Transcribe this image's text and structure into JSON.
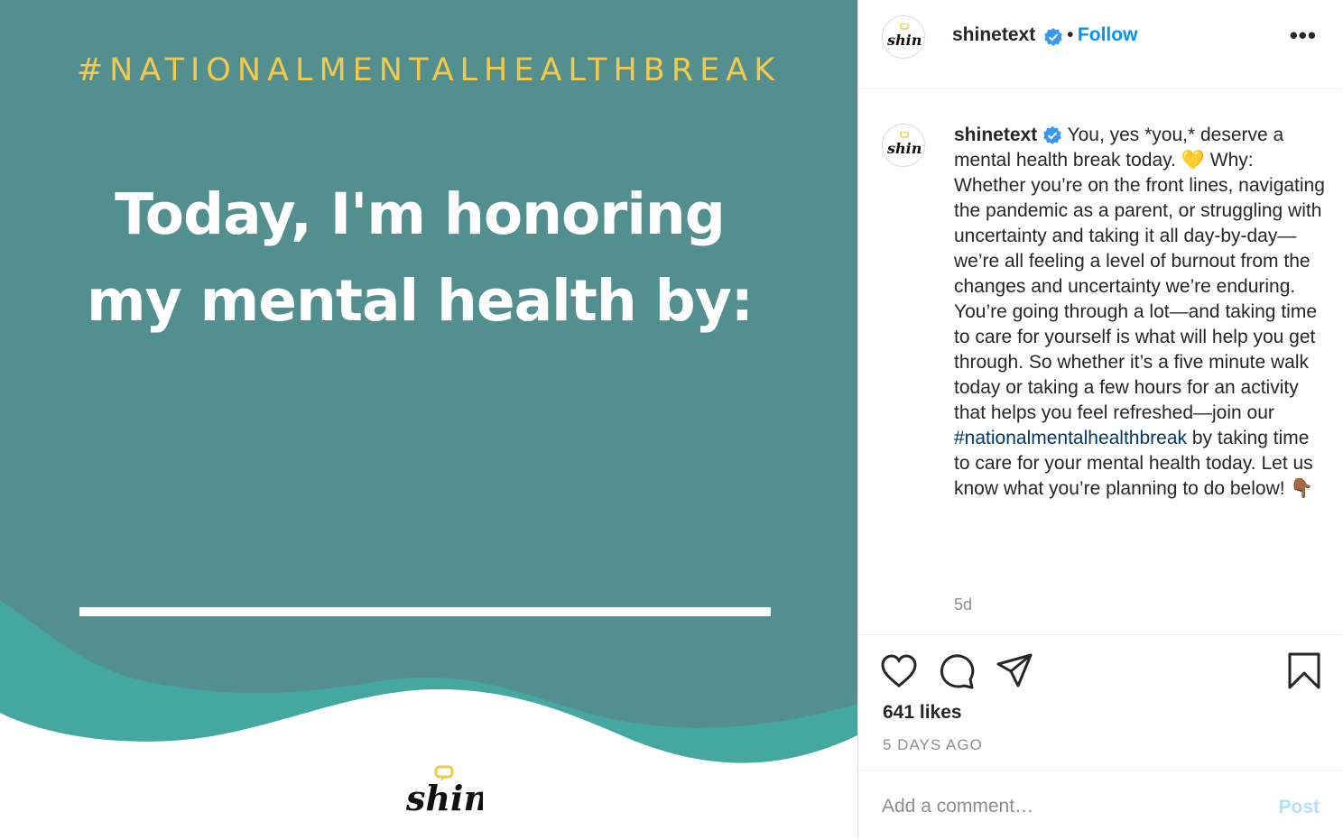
{
  "image": {
    "hashtag": "#NATIONALMENTALHEALTHBREAK",
    "headline_line1": "Today, I'm honoring",
    "headline_line2": "my mental health by:",
    "brand_logo_text": "shine",
    "colors": {
      "background": "#528f8e",
      "hashtag": "#f2c94c",
      "wave": "#44a7a0",
      "text": "#ffffff"
    }
  },
  "header": {
    "username": "shinetext",
    "separator": "•",
    "follow_label": "Follow",
    "more_label": "•••",
    "avatar_icon": "shine-logo-icon"
  },
  "caption": {
    "username": "shinetext",
    "text_part1": "You, yes *you,* deserve a mental health break today. 💛 Why: Whether you’re on the front lines, navigating the pandemic as a parent, or struggling with uncertainty and taking it all day-by-day—we’re all feeling a level of burnout from the changes and uncertainty we’re enduring. You’re going through a lot—and taking time to care for yourself is what will help you get through. So whether it’s a five minute walk today or taking a few hours for an activity that helps you feel refreshed—join our ",
    "hashtag": "#nationalmentalhealthbreak",
    "text_part2": " by taking time to care for your mental health today. Let us know what you’re planning to do below! 👇🏾",
    "time": "5d"
  },
  "actions": {
    "icons": [
      "heart-icon",
      "comment-icon",
      "share-icon",
      "bookmark-icon"
    ],
    "likes": "641 likes",
    "posted_ago": "5 DAYS AGO"
  },
  "comment": {
    "placeholder": "Add a comment…",
    "post_label": "Post"
  },
  "colors": {
    "accent": "#0095f6",
    "post_disabled": "#b2dffc",
    "muted": "#8e8e8e",
    "hashtag_link": "#00376b"
  }
}
